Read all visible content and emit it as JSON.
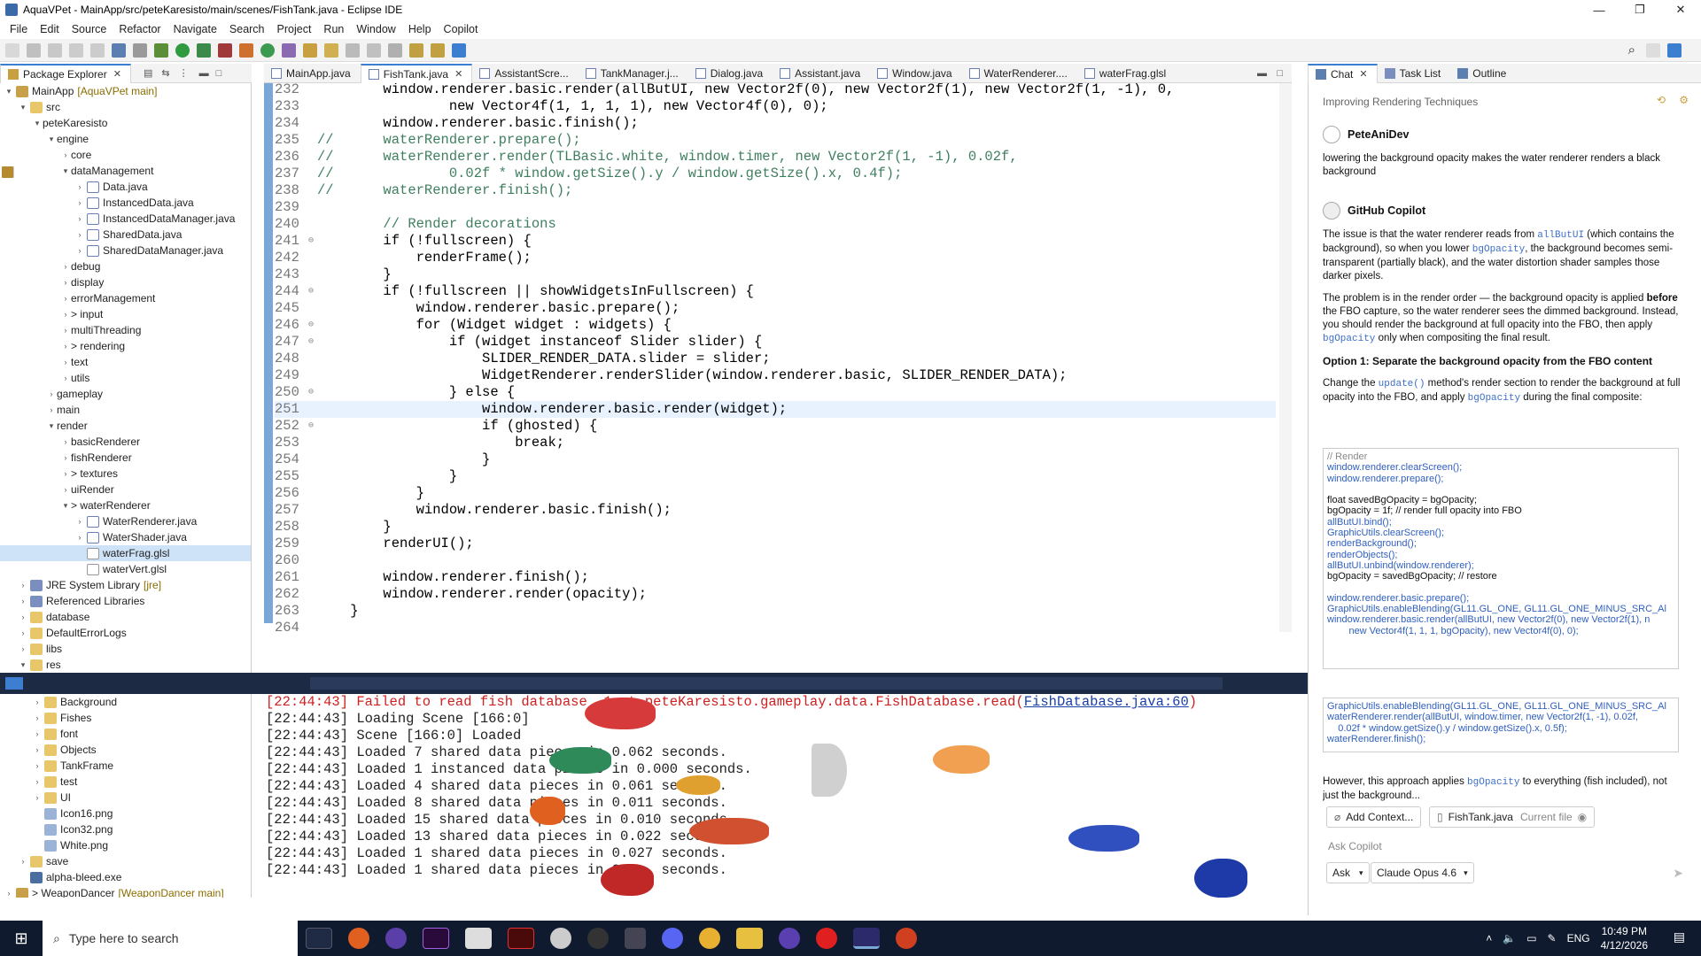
{
  "window": {
    "title": "AquaVPet - MainApp/src/peteKaresisto/main/scenes/FishTank.java - Eclipse IDE"
  },
  "menu": [
    "File",
    "Edit",
    "Source",
    "Refactor",
    "Navigate",
    "Search",
    "Project",
    "Run",
    "Window",
    "Help",
    "Copilot"
  ],
  "package_explorer": {
    "tab": "Package Explorer",
    "rows": [
      {
        "d": 0,
        "tw": "▾",
        "icon": "proj",
        "label": "MainApp",
        "git": "[AquaVPet main]"
      },
      {
        "d": 1,
        "tw": "▾",
        "icon": "folder",
        "label": "src"
      },
      {
        "d": 2,
        "tw": "▾",
        "icon": "pkg",
        "label": "peteKaresisto"
      },
      {
        "d": 3,
        "tw": "▾",
        "icon": "pkg",
        "label": "engine"
      },
      {
        "d": 4,
        "tw": "›",
        "icon": "pkg",
        "label": "core"
      },
      {
        "d": 4,
        "tw": "▾",
        "icon": "pkg",
        "label": "dataManagement"
      },
      {
        "d": 5,
        "tw": "›",
        "icon": "file",
        "label": "Data.java"
      },
      {
        "d": 5,
        "tw": "›",
        "icon": "file",
        "label": "InstancedData.java"
      },
      {
        "d": 5,
        "tw": "›",
        "icon": "file",
        "label": "InstancedDataManager.java"
      },
      {
        "d": 5,
        "tw": "›",
        "icon": "file",
        "label": "SharedData.java"
      },
      {
        "d": 5,
        "tw": "›",
        "icon": "file",
        "label": "SharedDataManager.java"
      },
      {
        "d": 4,
        "tw": "›",
        "icon": "pkg",
        "label": "debug"
      },
      {
        "d": 4,
        "tw": "›",
        "icon": "pkg",
        "label": "display"
      },
      {
        "d": 4,
        "tw": "›",
        "icon": "pkg",
        "label": "errorManagement"
      },
      {
        "d": 4,
        "tw": "›",
        "icon": "pkg",
        "label": "> input"
      },
      {
        "d": 4,
        "tw": "›",
        "icon": "pkg",
        "label": "multiThreading"
      },
      {
        "d": 4,
        "tw": "›",
        "icon": "pkg",
        "label": "> rendering"
      },
      {
        "d": 4,
        "tw": "›",
        "icon": "pkg",
        "label": "text"
      },
      {
        "d": 4,
        "tw": "›",
        "icon": "pkg",
        "label": "utils"
      },
      {
        "d": 3,
        "tw": "›",
        "icon": "pkg",
        "label": "gameplay"
      },
      {
        "d": 3,
        "tw": "›",
        "icon": "pkg",
        "label": "main"
      },
      {
        "d": 3,
        "tw": "▾",
        "icon": "pkg",
        "label": "render"
      },
      {
        "d": 4,
        "tw": "›",
        "icon": "pkg",
        "label": "basicRenderer"
      },
      {
        "d": 4,
        "tw": "›",
        "icon": "pkg",
        "label": "fishRenderer"
      },
      {
        "d": 4,
        "tw": "›",
        "icon": "pkg",
        "label": "> textures"
      },
      {
        "d": 4,
        "tw": "›",
        "icon": "pkg",
        "label": "uiRender"
      },
      {
        "d": 4,
        "tw": "▾",
        "icon": "pkg",
        "label": "> waterRenderer"
      },
      {
        "d": 5,
        "tw": "›",
        "icon": "file",
        "label": "WaterRenderer.java"
      },
      {
        "d": 5,
        "tw": "›",
        "icon": "file",
        "label": "WaterShader.java"
      },
      {
        "d": 5,
        "tw": "",
        "icon": "glsl",
        "label": "waterFrag.glsl",
        "sel": true
      },
      {
        "d": 5,
        "tw": "",
        "icon": "glsl",
        "label": "waterVert.glsl"
      },
      {
        "d": 1,
        "tw": "›",
        "icon": "lib",
        "label": "JRE System Library",
        "git": "[jre]"
      },
      {
        "d": 1,
        "tw": "›",
        "icon": "lib",
        "label": "Referenced Libraries"
      },
      {
        "d": 1,
        "tw": "›",
        "icon": "folder",
        "label": "database"
      },
      {
        "d": 1,
        "tw": "›",
        "icon": "folder",
        "label": "DefaultErrorLogs"
      },
      {
        "d": 1,
        "tw": "›",
        "icon": "folder",
        "label": "libs"
      },
      {
        "d": 1,
        "tw": "▾",
        "icon": "folder",
        "label": "res"
      }
    ],
    "lower_rows": [
      {
        "d": 2,
        "tw": "›",
        "icon": "folder",
        "label": "Background"
      },
      {
        "d": 2,
        "tw": "›",
        "icon": "folder",
        "label": "Fishes"
      },
      {
        "d": 2,
        "tw": "›",
        "icon": "folder",
        "label": "font"
      },
      {
        "d": 2,
        "tw": "›",
        "icon": "folder",
        "label": "Objects"
      },
      {
        "d": 2,
        "tw": "›",
        "icon": "folder",
        "label": "TankFrame"
      },
      {
        "d": 2,
        "tw": "›",
        "icon": "folder",
        "label": "test"
      },
      {
        "d": 2,
        "tw": "›",
        "icon": "folder",
        "label": "UI"
      },
      {
        "d": 2,
        "tw": "",
        "icon": "img",
        "label": "Icon16.png"
      },
      {
        "d": 2,
        "tw": "",
        "icon": "img",
        "label": "Icon32.png"
      },
      {
        "d": 2,
        "tw": "",
        "icon": "img",
        "label": "White.png"
      },
      {
        "d": 1,
        "tw": "›",
        "icon": "folder",
        "label": "save"
      },
      {
        "d": 1,
        "tw": "",
        "icon": "exe",
        "label": "alpha-bleed.exe"
      },
      {
        "d": 0,
        "tw": "›",
        "icon": "proj",
        "label": "> WeaponDancer",
        "git": "[WeaponDancer main]"
      }
    ]
  },
  "editor_tabs": [
    {
      "label": "MainApp.java"
    },
    {
      "label": "FishTank.java",
      "active": true
    },
    {
      "label": "AssistantScre..."
    },
    {
      "label": "TankManager.j..."
    },
    {
      "label": "Dialog.java"
    },
    {
      "label": "Assistant.java"
    },
    {
      "label": "Window.java"
    },
    {
      "label": "WaterRenderer...."
    },
    {
      "label": "waterFrag.glsl"
    }
  ],
  "code": [
    {
      "n": "232",
      "t": "        window.renderer.basic.render(allButUI, new Vector2f(0), new Vector2f(1), new Vector2f(1, -1), 0,"
    },
    {
      "n": "233",
      "t": "                new Vector4f(1, 1, 1, 1), new Vector4f(0), 0);"
    },
    {
      "n": "234",
      "t": "        window.renderer.basic.finish();"
    },
    {
      "n": "235",
      "t": "//      waterRenderer.prepare();",
      "c": "cm"
    },
    {
      "n": "236",
      "t": "//      waterRenderer.render(TLBasic.white, window.timer, new Vector2f(1, -1), 0.02f,",
      "c": "cm"
    },
    {
      "n": "237",
      "t": "//              0.02f * window.getSize().y / window.getSize().x, 0.4f);",
      "c": "cm"
    },
    {
      "n": "238",
      "t": "//      waterRenderer.finish();",
      "c": "cm"
    },
    {
      "n": "239",
      "t": ""
    },
    {
      "n": "240",
      "t": "        // Render decorations",
      "c": "cm"
    },
    {
      "n": "241",
      "t": "        if (!fullscreen) {",
      "f": "⊖"
    },
    {
      "n": "242",
      "t": "            renderFrame();"
    },
    {
      "n": "243",
      "t": "        }"
    },
    {
      "n": "244",
      "t": "        if (!fullscreen || showWidgetsInFullscreen) {",
      "f": "⊖"
    },
    {
      "n": "245",
      "t": "            window.renderer.basic.prepare();"
    },
    {
      "n": "246",
      "t": "            for (Widget widget : widgets) {",
      "f": "⊖"
    },
    {
      "n": "247",
      "t": "                if (widget instanceof Slider slider) {",
      "f": "⊖"
    },
    {
      "n": "248",
      "t": "                    SLIDER_RENDER_DATA.slider = slider;"
    },
    {
      "n": "249",
      "t": "                    WidgetRenderer.renderSlider(window.renderer.basic, SLIDER_RENDER_DATA);"
    },
    {
      "n": "250",
      "t": "                } else {",
      "f": "⊖"
    },
    {
      "n": "251",
      "t": "                    window.renderer.basic.render(widget);",
      "hl": true
    },
    {
      "n": "252",
      "t": "                    if (ghosted) {",
      "f": "⊖"
    },
    {
      "n": "253",
      "t": "                        break;"
    },
    {
      "n": "254",
      "t": "                    }"
    },
    {
      "n": "255",
      "t": "                }"
    },
    {
      "n": "256",
      "t": "            }"
    },
    {
      "n": "257",
      "t": "            window.renderer.basic.finish();"
    },
    {
      "n": "258",
      "t": "        }"
    },
    {
      "n": "259",
      "t": "        renderUI();"
    },
    {
      "n": "260",
      "t": ""
    },
    {
      "n": "261",
      "t": "        window.renderer.finish();"
    },
    {
      "n": "262",
      "t": "        window.renderer.render(opacity);"
    },
    {
      "n": "263",
      "t": "    }"
    },
    {
      "n": "264",
      "t": ""
    }
  ],
  "console": [
    {
      "t": "[22:44:43] Failed to read fish database ",
      "err": true,
      "tail": " 1 at peteKaresisto.gameplay.data.FishDatabase.read(",
      "link": "FishDatabase.java:60",
      "end": ")"
    },
    {
      "t": "[22:44:43] Loading Scene [166:0]"
    },
    {
      "t": "[22:44:43] Scene [166:0] Loaded"
    },
    {
      "t": "[22:44:43] Loaded 7 shared data pieces in 0.062 seconds."
    },
    {
      "t": "[22:44:43] Loaded 1 instanced data pieces in 0.000 seconds."
    },
    {
      "t": "[22:44:43] Loaded 4 shared data pieces in 0.061 seconds."
    },
    {
      "t": "[22:44:43] Loaded 8 shared data pieces in 0.011 seconds."
    },
    {
      "t": "[22:44:43] Loaded 15 shared data pieces in 0.010 seconds."
    },
    {
      "t": "[22:44:43] Loaded 13 shared data pieces in 0.022 seconds."
    },
    {
      "t": "[22:44:43] Loaded 1 shared data pieces in 0.027 seconds."
    },
    {
      "t": "[22:44:43] Loaded 1 shared data pieces in 0.0.. seconds."
    }
  ],
  "chat": {
    "tabs": [
      "Chat",
      "Task List",
      "Outline"
    ],
    "conversation_title": "Improving Rendering Techniques",
    "user_name": "PeteAniDev",
    "user_msg": "lowering the background opacity makes the water renderer renders a black background",
    "bot_name": "GitHub Copilot",
    "p1_a": "The issue is that the water renderer reads from ",
    "p1_code1": "allButUI",
    "p1_b": " (which contains the background), so when you lower ",
    "p1_code2": "bgOpacity",
    "p1_c": ", the background becomes semi-transparent (partially black), and the water distortion shader samples those darker pixels.",
    "p2_a": "The problem is in the render order — the background opacity is applied ",
    "p2_bold": "before",
    "p2_b": " the FBO capture, so the water renderer sees the dimmed background. Instead, you should render the background at full opacity into the FBO, then apply ",
    "p2_code": "bgOpacity",
    "p2_c": " only when compositing the final result.",
    "option1": "Option 1: Separate the background opacity from the FBO content",
    "p3_a": "Change the ",
    "p3_code1": "update()",
    "p3_b": " method's render section to render the background at full opacity into the FBO, and apply ",
    "p3_code2": "bgOpacity",
    "p3_c": " during the final composite:",
    "code_lines": [
      {
        "t": "// Render",
        "c": "cm"
      },
      {
        "t": "window.renderer.clearScreen();",
        "c": "m"
      },
      {
        "t": "window.renderer.prepare();",
        "c": "m"
      },
      {
        "t": ""
      },
      {
        "t": "float savedBgOpacity = bgOpacity;"
      },
      {
        "t": "bgOpacity = 1f; // render full opacity into FBO"
      },
      {
        "t": "allButUI.bind();",
        "c": "m"
      },
      {
        "t": "GraphicUtils.clearScreen();",
        "c": "m"
      },
      {
        "t": "renderBackground();",
        "c": "m"
      },
      {
        "t": "renderObjects();",
        "c": "m"
      },
      {
        "t": "allButUI.unbind(window.renderer);",
        "c": "m"
      },
      {
        "t": "bgOpacity = savedBgOpacity; // restore"
      },
      {
        "t": ""
      },
      {
        "t": "window.renderer.basic.prepare();",
        "c": "m"
      },
      {
        "t": "GraphicUtils.enableBlending(GL11.GL_ONE, GL11.GL_ONE_MINUS_SRC_Al",
        "c": "m"
      },
      {
        "t": "window.renderer.basic.render(allButUI, new Vector2f(0), new Vector2f(1), n",
        "c": "m"
      },
      {
        "t": "        new Vector4f(1, 1, 1, bgOpacity), new Vector4f(0), 0);",
        "c": "m"
      }
    ],
    "code_lines2": [
      {
        "t": "GraphicUtils.enableBlending(GL11.GL_ONE, GL11.GL_ONE_MINUS_SRC_Al",
        "c": "m"
      },
      {
        "t": "waterRenderer.render(allButUI, window.timer, new Vector2f(1, -1), 0.02f,",
        "c": "m"
      },
      {
        "t": "    0.02f * window.getSize().y / window.getSize().x, 0.5f);",
        "c": "m"
      },
      {
        "t": "waterRenderer.finish();",
        "c": "m"
      }
    ],
    "p4_a": "However, this approach applies ",
    "p4_code": "bgOpacity",
    "p4_b": " to everything (fish included), not just the background...",
    "add_context": "Add Context...",
    "file_chip": "FishTank.java",
    "file_chip_hint": "Current file",
    "input_placeholder": "Ask Copilot",
    "mode": "Ask",
    "model": "Claude Opus 4.6"
  },
  "taskbar": {
    "search_placeholder": "Type here to search",
    "lang": "ENG",
    "time": "10:49 PM",
    "date": "4/12/2026"
  },
  "colors": {
    "accent": "#3c7fd0",
    "error": "#d02020",
    "taskbar": "#101a2e"
  }
}
